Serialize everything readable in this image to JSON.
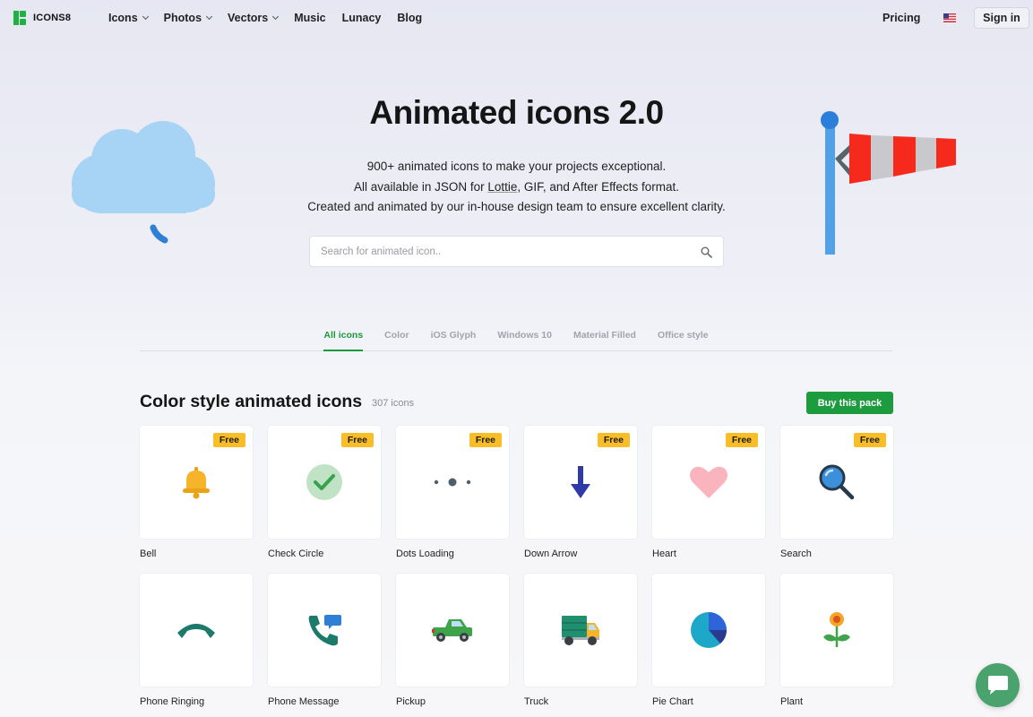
{
  "header": {
    "logo_text": "ICONS8",
    "nav": [
      {
        "label": "Icons",
        "dropdown": true
      },
      {
        "label": "Photos",
        "dropdown": true
      },
      {
        "label": "Vectors",
        "dropdown": true
      },
      {
        "label": "Music",
        "dropdown": false
      },
      {
        "label": "Lunacy",
        "dropdown": false
      },
      {
        "label": "Blog",
        "dropdown": false
      }
    ],
    "pricing": "Pricing",
    "sign_in": "Sign in",
    "language_icon": "us-flag-icon"
  },
  "hero": {
    "title": "Animated icons 2.0",
    "line1": "900+ animated icons to make your projects exceptional.",
    "line2_pre": "All available in JSON for ",
    "line2_link": "Lottie",
    "line2_post": ", GIF, and After Effects format.",
    "line3": "Created and animated by our in-house design team to ensure excellent clarity.",
    "search_placeholder": "Search for animated icon.."
  },
  "tabs": [
    {
      "label": "All icons",
      "active": true
    },
    {
      "label": "Color",
      "active": false
    },
    {
      "label": "iOS Glyph",
      "active": false
    },
    {
      "label": "Windows 10",
      "active": false
    },
    {
      "label": "Material Filled",
      "active": false
    },
    {
      "label": "Office style",
      "active": false
    }
  ],
  "section": {
    "title": "Color style animated icons",
    "count": "307 icons",
    "buy_button": "Buy this pack"
  },
  "icons": [
    {
      "label": "Bell",
      "badge": "Free",
      "icon": "bell-icon"
    },
    {
      "label": "Check Circle",
      "badge": "Free",
      "icon": "check-circle-icon"
    },
    {
      "label": "Dots Loading",
      "badge": "Free",
      "icon": "dots-loading-icon"
    },
    {
      "label": "Down Arrow",
      "badge": "Free",
      "icon": "down-arrow-icon"
    },
    {
      "label": "Heart",
      "badge": "Free",
      "icon": "heart-icon"
    },
    {
      "label": "Search",
      "badge": "Free",
      "icon": "search-icon"
    },
    {
      "label": "Phone Ringing",
      "badge": "",
      "icon": "phone-ringing-icon"
    },
    {
      "label": "Phone Message",
      "badge": "",
      "icon": "phone-message-icon"
    },
    {
      "label": "Pickup",
      "badge": "",
      "icon": "pickup-icon"
    },
    {
      "label": "Truck",
      "badge": "",
      "icon": "truck-icon"
    },
    {
      "label": "Pie Chart",
      "badge": "",
      "icon": "pie-chart-icon"
    },
    {
      "label": "Plant",
      "badge": "",
      "icon": "plant-icon"
    }
  ],
  "colors": {
    "accent_green": "#1d9b3f",
    "badge_yellow": "#f9bd27"
  }
}
